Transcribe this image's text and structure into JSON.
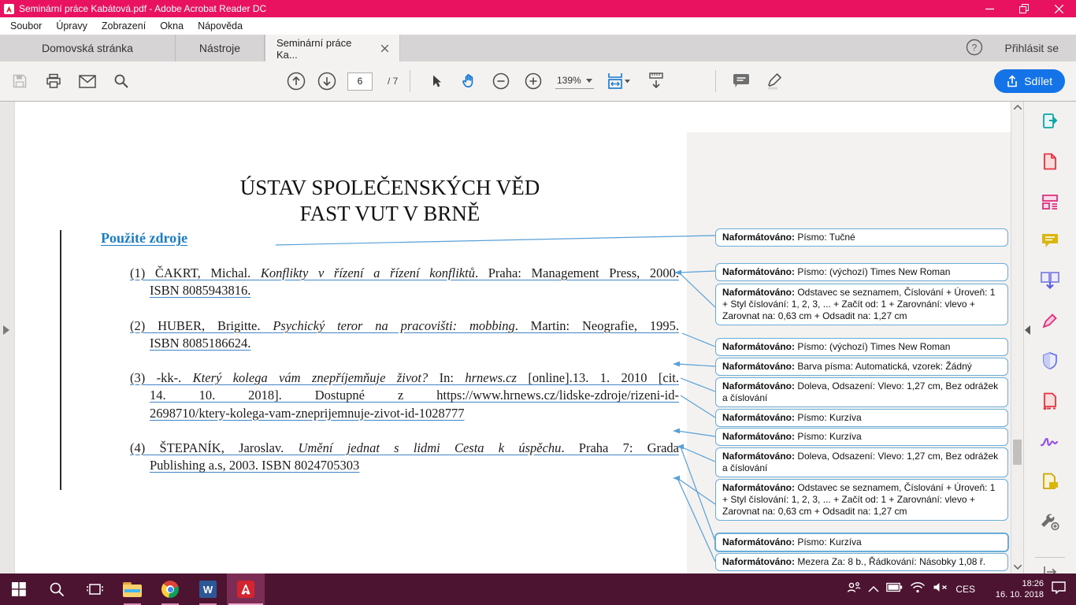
{
  "window": {
    "title": "Seminární práce Kabátová.pdf - Adobe Acrobat Reader DC"
  },
  "menubar": {
    "items": [
      "Soubor",
      "Úpravy",
      "Zobrazení",
      "Okna",
      "Nápověda"
    ]
  },
  "tabbar": {
    "tabs": [
      {
        "label": "Domovská stránka"
      },
      {
        "label": "Nástroje"
      },
      {
        "label": "Seminární práce Ka...",
        "closable": true,
        "active": true
      }
    ],
    "signin_label": "Přihlásit se"
  },
  "toolbar": {
    "page_current": "6",
    "page_total": "/ 7",
    "zoom_level": "139%",
    "share_label": "Sdílet"
  },
  "document": {
    "title_line1": "ÚSTAV SPOLEČENSKÝCH VĚD",
    "title_line2": "FAST VUT V BRNĚ",
    "heading": "Použité zdroje",
    "references": [
      {
        "num": "(1)",
        "lines": [
          {
            "fill": true,
            "seg": [
              {
                "t": "ČAKRT, Michal. "
              },
              {
                "t": "Konflikty v řízení a řízení konfliktů",
                "i": true
              },
              {
                "t": ". Praha: Management Press, 2000."
              }
            ]
          },
          {
            "fill": false,
            "seg": [
              {
                "t": "ISBN 8085943816."
              }
            ]
          }
        ]
      },
      {
        "num": "(2)",
        "lines": [
          {
            "fill": true,
            "seg": [
              {
                "t": "HUBER, Brigitte. "
              },
              {
                "t": "Psychický teror na pracovišti: mobbing",
                "i": true
              },
              {
                "t": ". Martin: Neografie, 1995."
              }
            ]
          },
          {
            "fill": false,
            "seg": [
              {
                "t": "ISBN 8085186624."
              }
            ]
          }
        ]
      },
      {
        "num": "(3)",
        "lines": [
          {
            "fill": true,
            "seg": [
              {
                "t": "-kk-. "
              },
              {
                "t": "Který kolega vám znepříjemňuje život?",
                "i": true
              },
              {
                "t": " In: "
              },
              {
                "t": "hrnews.cz",
                "i": true
              },
              {
                "t": " [online].13. 1. 2010 [cit."
              }
            ]
          },
          {
            "fill": true,
            "seg": [
              {
                "t": "14. 10. 2018]. Dostupné z https://www.hrnews.cz/lidske-zdroje/rizeni-id-"
              }
            ]
          },
          {
            "fill": false,
            "seg": [
              {
                "t": "2698710/ktery-kolega-vam-zneprijemnuje-zivot-id-1028777"
              }
            ]
          }
        ]
      },
      {
        "num": "(4)",
        "lines": [
          {
            "fill": true,
            "seg": [
              {
                "t": "ŠTEPANÍK, Jaroslav. "
              },
              {
                "t": "Umění jednat s lidmi Cesta k úspěchu",
                "i": true
              },
              {
                "t": ". Praha 7: Grada"
              }
            ]
          },
          {
            "fill": false,
            "seg": [
              {
                "t": "Publishing a.s, 2003. ISBN 8024705303"
              }
            ]
          }
        ]
      }
    ]
  },
  "annotations": [
    {
      "label": "Naformátováno:",
      "text": "Písmo: Tučné"
    },
    {
      "label": "Naformátováno:",
      "text": "Písmo: (výchozí) Times New Roman"
    },
    {
      "label": "Naformátováno:",
      "text": "Odstavec se seznamem, Číslování + Úroveň: 1 + Styl číslování: 1, 2, 3, ... + Začít od: 1 + Zarovnání: vlevo + Zarovnat na:  0,63 cm + Odsadit na:  1,27 cm"
    },
    {
      "label": "Naformátováno:",
      "text": "Písmo: (výchozí) Times New Roman"
    },
    {
      "label": "Naformátováno:",
      "text": "Barva písma: Automatická, vzorek: Žádný"
    },
    {
      "label": "Naformátováno:",
      "text": "Doleva, Odsazení: Vlevo:  1,27 cm,  Bez odrážek a číslování"
    },
    {
      "label": "Naformátováno:",
      "text": "Písmo: Kurzíva"
    },
    {
      "label": "Naformátováno:",
      "text": "Písmo: Kurzíva"
    },
    {
      "label": "Naformátováno:",
      "text": "Doleva, Odsazení: Vlevo:  1,27 cm,  Bez odrážek a číslování"
    },
    {
      "label": "Naformátováno:",
      "text": "Odstavec se seznamem, Číslování + Úroveň: 1 + Styl číslování: 1, 2, 3, ... + Začít od: 1 + Zarovnání: vlevo + Zarovnat na:  0,63 cm + Odsadit na:  1,27 cm"
    },
    {
      "label": "Naformátováno:",
      "text": "Písmo: Kurzíva",
      "selected": true
    },
    {
      "label": "Naformátováno:",
      "text": "Mezera Za:  8 b., Řádkování:  Násobky 1,08 ř."
    }
  ],
  "icons": {
    "sidebar_tools": [
      "export-pdf",
      "create-pdf",
      "edit-pdf",
      "comment",
      "combine-files",
      "fill-and-sign",
      "protect",
      "redact",
      "adobe-sign",
      "send-for-comments",
      "more-tools"
    ],
    "taskbar": [
      "start",
      "search",
      "task-view",
      "file-explorer",
      "chrome",
      "word",
      "acrobat"
    ],
    "tray": [
      "people",
      "hidden-icons-chevron",
      "battery",
      "wifi",
      "volume-muted",
      "language",
      "clock",
      "action-center"
    ]
  },
  "colors": {
    "titlebar": "#e81261",
    "accent_blue": "#1473e6",
    "heading_blue": "#1a7dc6",
    "annotation_border": "#6aadd9",
    "taskbar": "#4c1431"
  },
  "taskbar": {
    "language": "CES",
    "time": "18:26",
    "date": "16. 10. 2018"
  }
}
